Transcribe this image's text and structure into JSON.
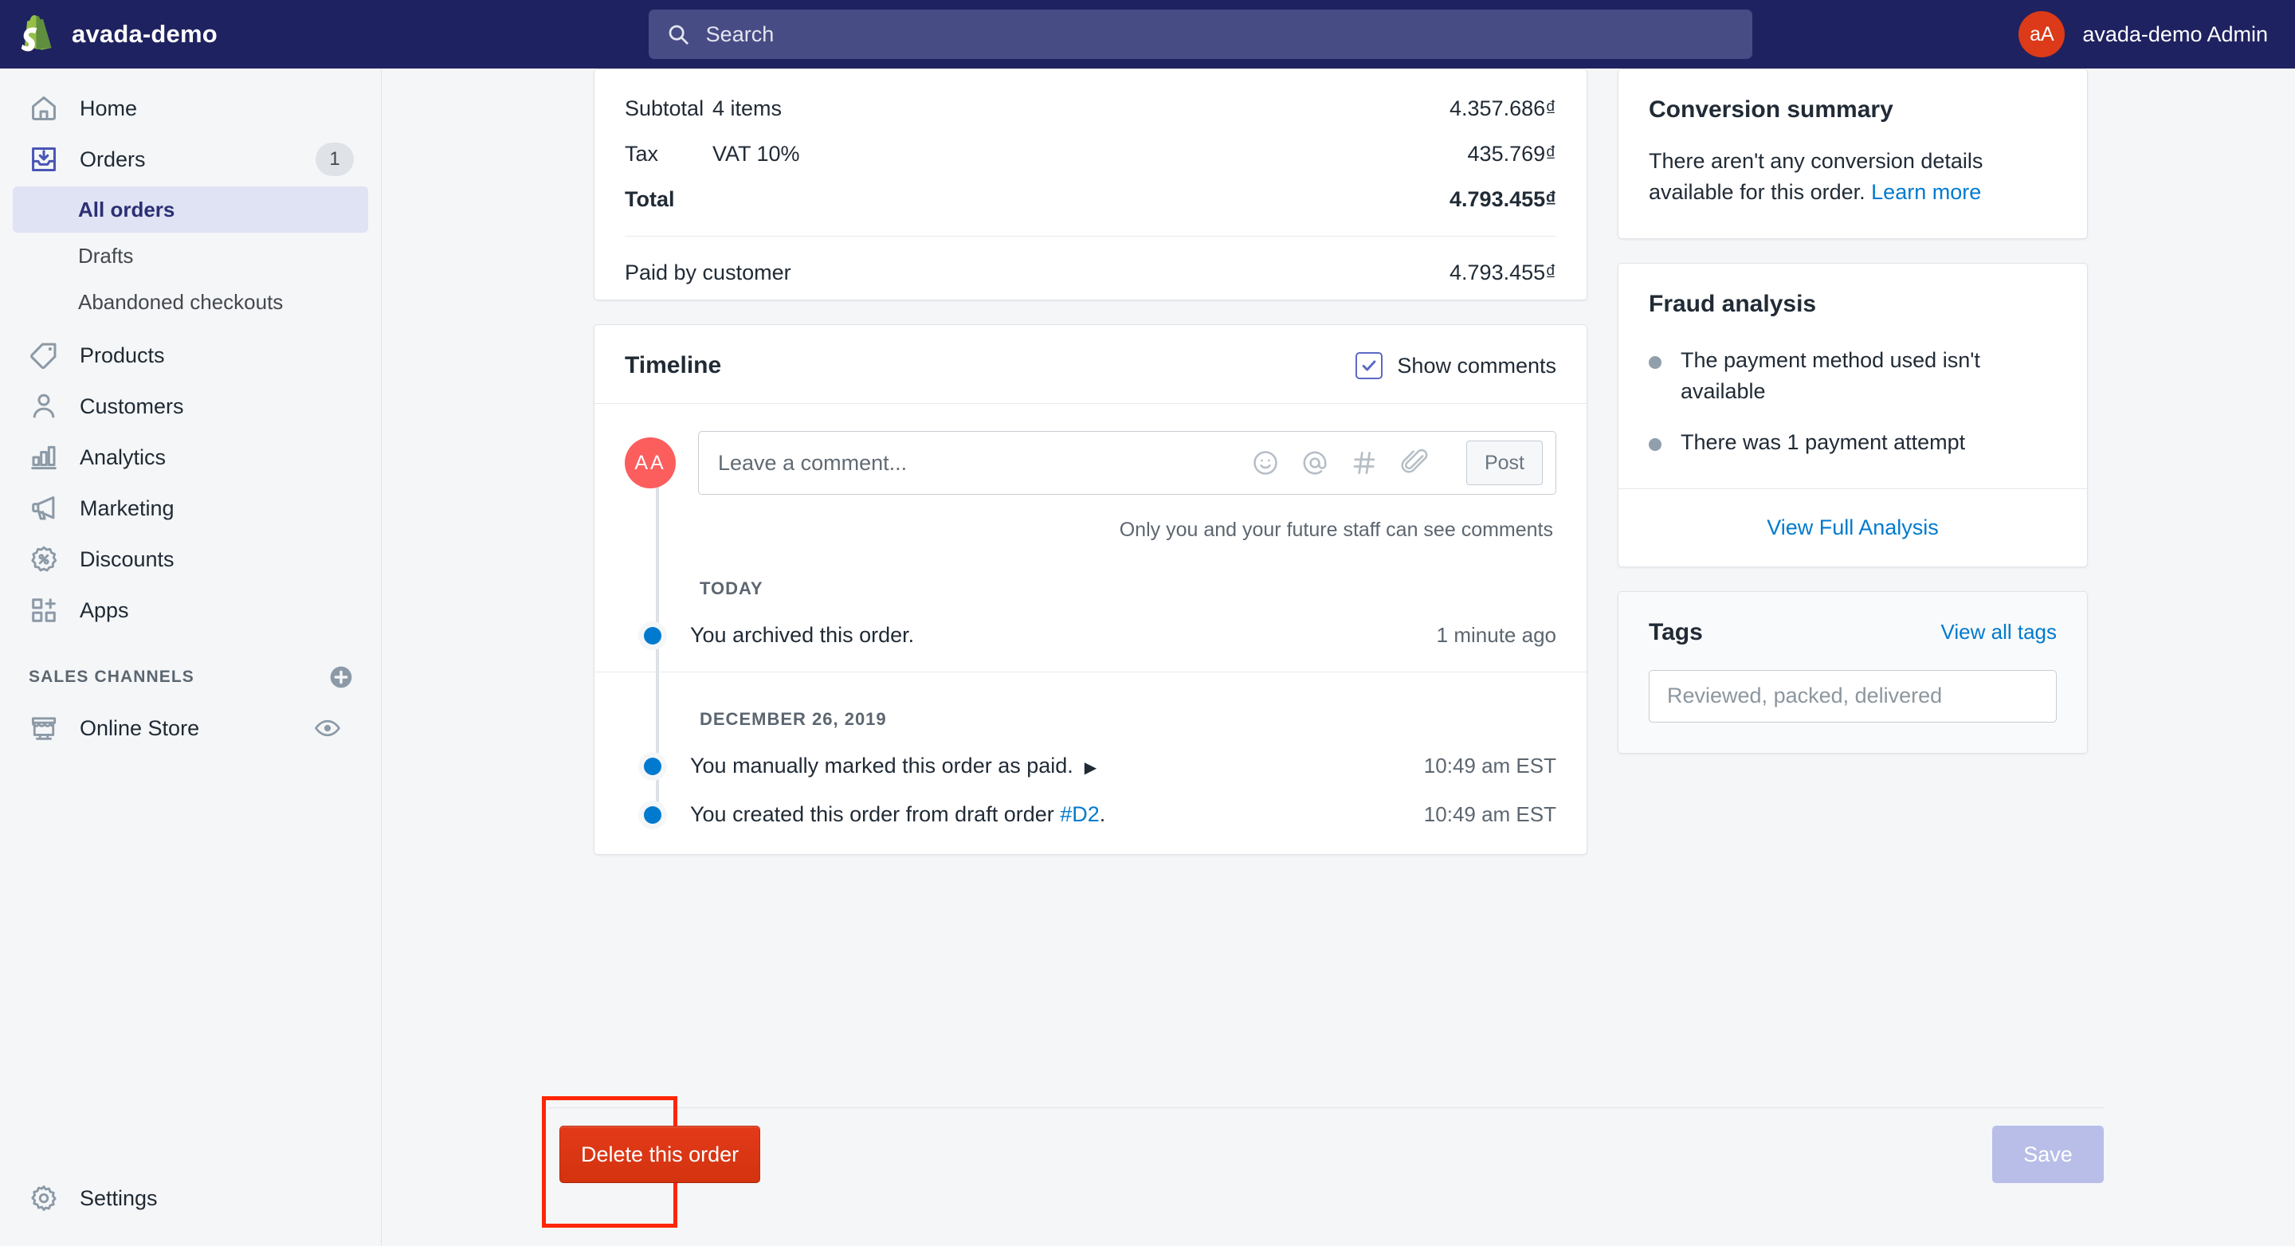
{
  "topbar": {
    "logo_icon": "shopify-bag-icon",
    "brand_name": "avada-demo",
    "search": {
      "placeholder": "Search",
      "icon": "search-icon"
    },
    "user": {
      "initials": "aA",
      "name": "avada-demo Admin"
    }
  },
  "sidebar": {
    "items": [
      {
        "label": "Home",
        "icon": "home-icon"
      },
      {
        "label": "Orders",
        "icon": "orders-inbox-icon",
        "badge": "1"
      },
      {
        "label": "Products",
        "icon": "tag-icon"
      },
      {
        "label": "Customers",
        "icon": "person-icon"
      },
      {
        "label": "Analytics",
        "icon": "bar-chart-icon"
      },
      {
        "label": "Marketing",
        "icon": "megaphone-icon"
      },
      {
        "label": "Discounts",
        "icon": "percent-badge-icon"
      },
      {
        "label": "Apps",
        "icon": "apps-grid-icon"
      }
    ],
    "orders_subnav": [
      {
        "label": "All orders",
        "active": true
      },
      {
        "label": "Drafts",
        "active": false
      },
      {
        "label": "Abandoned checkouts",
        "active": false
      }
    ],
    "sales_channels": {
      "title": "SALES CHANNELS",
      "add_icon": "plus-circle-icon",
      "items": [
        {
          "label": "Online Store",
          "icon": "storefront-icon",
          "action_icon": "eye-icon"
        }
      ]
    },
    "settings": {
      "label": "Settings",
      "icon": "gear-icon"
    }
  },
  "order_summary": {
    "rows": [
      {
        "label": "Subtotal",
        "desc": "4 items",
        "amount": "4.357.686₫",
        "bold": false
      },
      {
        "label": "Tax",
        "desc": "VAT 10%",
        "amount": "435.769₫",
        "bold": false
      },
      {
        "label": "Total",
        "desc": "",
        "amount": "4.793.455₫",
        "bold": true
      }
    ],
    "paid": {
      "label": "Paid by customer",
      "amount": "4.793.455₫"
    }
  },
  "timeline": {
    "title": "Timeline",
    "show_comments_label": "Show comments",
    "show_comments_checked": true,
    "commenter_initials": "AA",
    "comment_placeholder": "Leave a comment...",
    "comment_icons": [
      "emoji-icon",
      "mention-icon",
      "hashtag-icon",
      "attachment-icon"
    ],
    "post_label": "Post",
    "privacy_note": "Only you and your future staff can see comments",
    "groups": [
      {
        "date": "TODAY",
        "events": [
          {
            "text": "You archived this order.",
            "time": "1 minute ago",
            "link": null,
            "expandable": false
          }
        ]
      },
      {
        "date": "DECEMBER 26, 2019",
        "events": [
          {
            "text": "You manually marked this order as paid.",
            "time": "10:49 am EST",
            "link": null,
            "expandable": true
          },
          {
            "text_before": "You created this order from draft order ",
            "link": "#D2",
            "text_after": ".",
            "time": "10:49 am EST",
            "expandable": false
          }
        ]
      }
    ]
  },
  "conversion_summary": {
    "title": "Conversion summary",
    "text": "There aren't any conversion details available for this order. ",
    "link": "Learn more"
  },
  "fraud_analysis": {
    "title": "Fraud analysis",
    "items": [
      "The payment method used isn't available",
      "There was 1 payment attempt"
    ],
    "footer_link": "View Full Analysis"
  },
  "tags": {
    "title": "Tags",
    "view_all_label": "View all tags",
    "input_placeholder": "Reviewed, packed, delivered"
  },
  "actions": {
    "delete_label": "Delete this order",
    "save_label": "Save",
    "highlight_color": "#FF2600"
  },
  "colors": {
    "topbar_bg": "#1F2260",
    "accent_blue": "#007ACE",
    "indigo": "#5C6AC4",
    "danger_red": "#D3330F",
    "avatar_red": "#DC3A18",
    "timeline_avatar": "#FC5D5D"
  }
}
